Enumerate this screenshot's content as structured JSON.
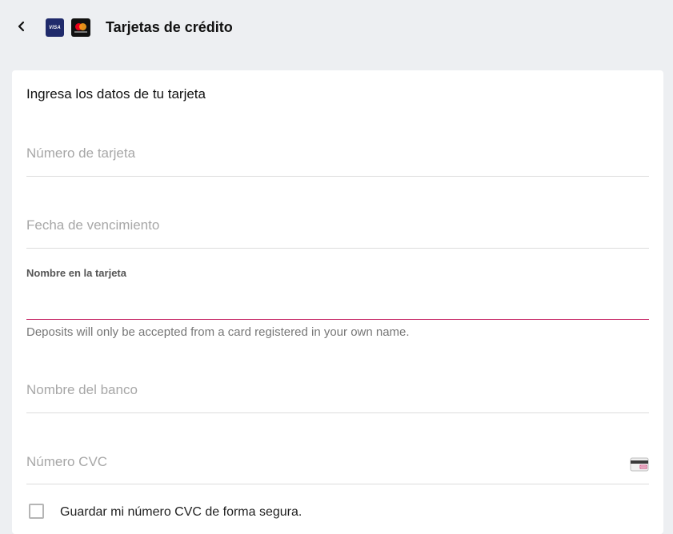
{
  "header": {
    "title": "Tarjetas de crédito",
    "back_icon": "chevron-left-icon",
    "brands": [
      "VISA",
      "Mastercard"
    ],
    "visa_text": "VISA"
  },
  "form": {
    "section_title": "Ingresa los datos de tu tarjeta",
    "card_number_placeholder": "Número de tarjeta",
    "expiry_placeholder": "Fecha de vencimiento",
    "name_label": "Nombre en la tarjeta",
    "name_value": "",
    "name_helper": "Deposits will only be accepted from a card registered in your own name.",
    "bank_placeholder": "Nombre del banco",
    "cvc_placeholder": "Número CVC",
    "cvc_icon": "card-back-icon",
    "save_cvc_label": "Guardar mi número CVC de forma segura.",
    "save_cvc_checked": false
  },
  "colors": {
    "background": "#edeff2",
    "card": "#ffffff",
    "accent": "#c2185b",
    "placeholder": "#a7a7a7",
    "visa_blue": "#1f2a6b"
  }
}
